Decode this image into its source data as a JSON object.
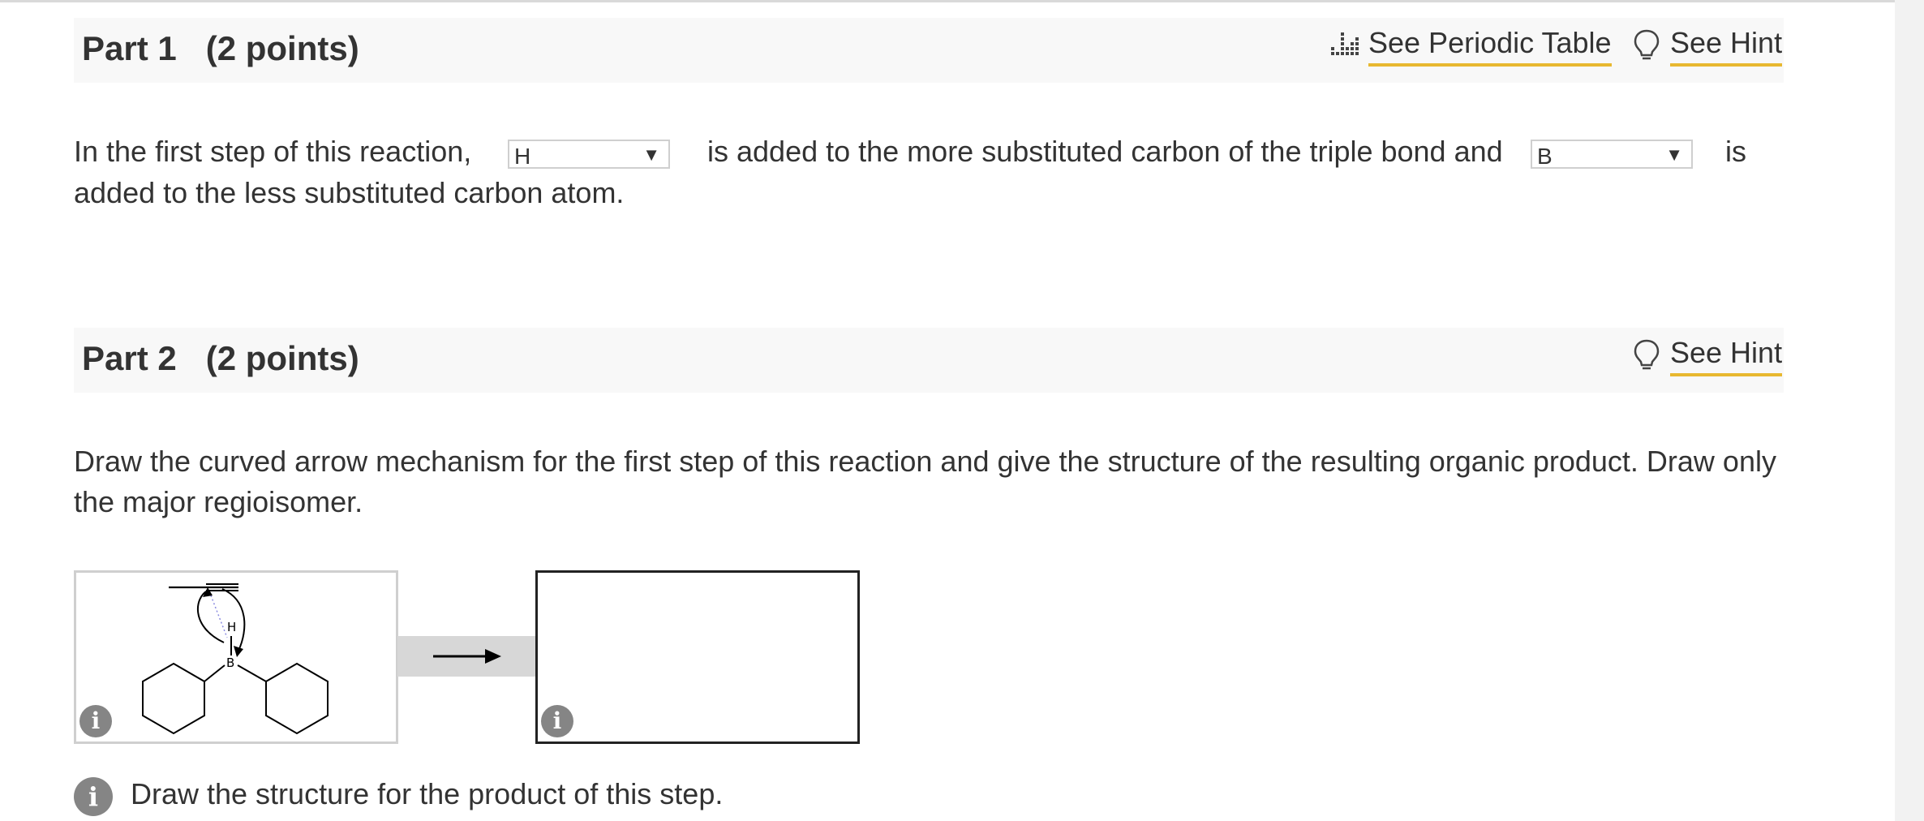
{
  "part1": {
    "title": "Part 1",
    "points": "(2 points)",
    "periodic_link": "See Periodic Table",
    "hint_link": "See Hint",
    "sentence_a": "In the first step of this reaction,",
    "select_1_value": "H",
    "sentence_b": "is added to the more substituted carbon of the triple bond and",
    "select_2_value": "B",
    "sentence_c": "is",
    "sentence_d": "added to the less substituted carbon atom."
  },
  "part2": {
    "title": "Part 2",
    "points": "(2 points)",
    "hint_link": "See Hint",
    "instructions_line1": "Draw the curved arrow mechanism for the first step of this reaction and give the structure of the resulting organic product. Draw only",
    "instructions_line2": "the major regioisomer.",
    "reactant_atoms": {
      "h": "H",
      "b": "B"
    },
    "info_glyph": "i",
    "footer_note": "Draw the structure for the product of this step."
  },
  "colors": {
    "accent_underline": "#e8b830",
    "header_bg": "#f8f8f8",
    "info_icon": "#858585"
  }
}
